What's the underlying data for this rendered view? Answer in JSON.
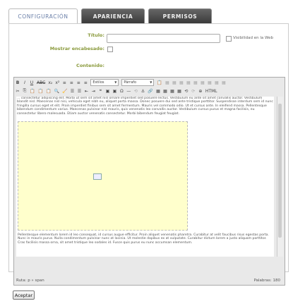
{
  "tabs": [
    {
      "label": "CONFIGURACIÓN",
      "active": true
    },
    {
      "label": "APARIENCIA",
      "active": false
    },
    {
      "label": "PERMISOS",
      "active": false
    }
  ],
  "form": {
    "title_label": "Título:",
    "title_value": "",
    "show_header_label": "Mostrar encabesado:",
    "visibility_label": "Visibilidad en la Web",
    "content_label": "Contenido:"
  },
  "toolbar": {
    "row1": [
      "B",
      "I",
      "U",
      "ABC",
      "x₂",
      "x²",
      "≡",
      "≡",
      "≡",
      "≡"
    ],
    "styles_combo": "Estilos",
    "format_combo": "Párrafo",
    "row1_tail": [
      "📋",
      "▦",
      "▦",
      "▦",
      "▦",
      "▦",
      "▦",
      "▦",
      "▦",
      "▦"
    ],
    "row2": [
      "✂",
      "⎘",
      "📋",
      "📋",
      "📋",
      "🔍",
      "🧹",
      "☰",
      "☰",
      "⇤",
      "⇥",
      "❝",
      "▣",
      "▣",
      "Ω",
      "—",
      "⟲",
      "⚓",
      "🔗",
      "▦",
      "▦",
      "▦",
      "▦",
      "⟲",
      "⟳",
      "⊕",
      "HTML"
    ]
  },
  "editor_text": {
    "para1": "... consectetur adipiscing elit. Morbi ut sem sit amet nisl ornare imperdiet sed posuere lectus. Vestibulum eu ante sit amet convallis auctor. Vestibulum blandit nisl. Maecenas nisl nisi, vehicula eget nibh eu, aliquet porta massa. Donec posuere dui sed ante tristique porttitor. Suspendisse interdum sem id nunc fringilla cursus eget et elit. Proin imperdiet finibus sem sit amet fermentum. Mauris vel commodo odio. Ut et cursus ante. In eleifend massa. Pellentesque bibendum condimentum varius. Maecenas pulvinar nisl mauris, quis venenatis leo convallis auctor. Vestibulum cursus purus et magna facilisis, eu consectetur libero malesuada. Etiam auctor venenatis consectetur. Morbi bibendum feugiat feugiat.",
    "para2": "Pellentesque elementum lorem id leo consequat, id cursus augue efficitur. Proin aliquet venenatis pharetra. Curabitur at velit faucibus risus egestas porta. Nunc in mauris purus. Nulla condimentum pulvinar nunc at lacinia. Ut molestie dapibus ex at vulputate. Curabitur dictum lorem a justo aliquam porttitor. Cras facilisis massa orna, sit amet tristique leo sodales id. Fusce quis purus eu nunc accumsan elementum."
  },
  "status": {
    "path": "Ruta: p » span",
    "words": "Palabras: 180"
  },
  "submit_label": "Aceptar"
}
